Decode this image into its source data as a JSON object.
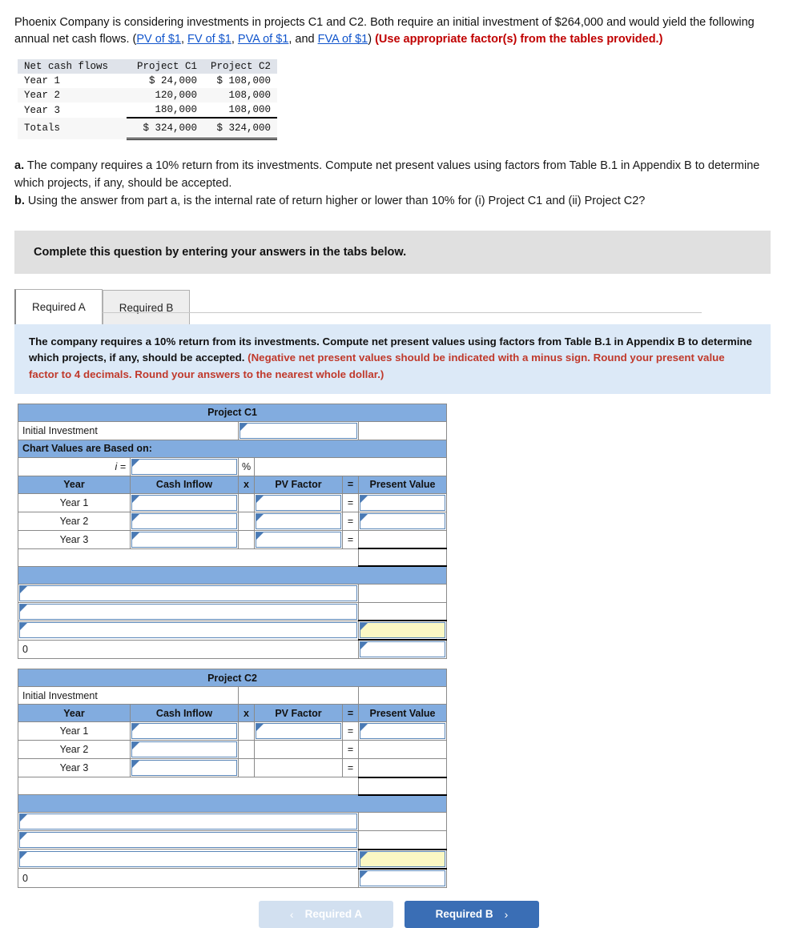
{
  "intro": {
    "text_part1": "Phoenix Company is considering investments in projects C1 and C2. Both require an initial investment of $264,000 and would yield the following annual net cash flows. (",
    "link_pv": "PV of $1",
    "sep1": ", ",
    "link_fv": "FV of $1",
    "sep2": ", ",
    "link_pva": "PVA of $1",
    "sep3": ", and ",
    "link_fva": "FVA of $1",
    "sep4": ") ",
    "bold_red": "(Use appropriate factor(s) from the tables provided.)"
  },
  "cash_table": {
    "headers": [
      "Net cash flows",
      "Project C1",
      "Project C2"
    ],
    "rows": [
      {
        "label": "Year 1",
        "c1": "$ 24,000",
        "c2": "$ 108,000"
      },
      {
        "label": "Year 2",
        "c1": "120,000",
        "c2": "108,000"
      },
      {
        "label": "Year 3",
        "c1": "180,000",
        "c2": "108,000"
      }
    ],
    "totals": {
      "label": "Totals",
      "c1": "$ 324,000",
      "c2": "$ 324,000"
    }
  },
  "questions": {
    "a_marker": "a.",
    "a_text": " The company requires a 10% return from its investments. Compute net present values using factors from Table B.1 in Appendix B to determine which projects, if any, should be accepted.",
    "b_marker": "b.",
    "b_text": " Using the answer from part a, is the internal rate of return higher or lower than 10% for (i) Project C1 and (ii) Project C2?"
  },
  "banner": {
    "text": "Complete this question by entering your answers in the tabs below."
  },
  "tabs": [
    {
      "label": "Required A",
      "active": true
    },
    {
      "label": "Required B",
      "active": false
    }
  ],
  "instruction_panel": {
    "black_text": "The company requires a 10% return from its investments. Compute net present values using factors from Table B.1 in Appendix B to determine which projects, if any, should be accepted. ",
    "red_text": "(Negative net present values should be indicated with a minus sign. Round your present value factor to 4 decimals. Round your answers to the nearest whole dollar.)"
  },
  "grid_c1": {
    "title": "Project C1",
    "initial_investment_label": "Initial Investment",
    "initial_investment_value": "",
    "chart_values_label": "Chart Values are Based on:",
    "i_label": "i =",
    "i_value": "",
    "percent_symbol": "%",
    "columns": [
      "Year",
      "Cash Inflow",
      "x",
      "PV Factor",
      "=",
      "Present Value"
    ],
    "rows": [
      {
        "year": "Year 1",
        "cash_inflow": "",
        "pv_factor": "",
        "equals": "=",
        "present_value": ""
      },
      {
        "year": "Year 2",
        "cash_inflow": "",
        "pv_factor": "",
        "equals": "=",
        "present_value": ""
      },
      {
        "year": "Year 3",
        "cash_inflow": "",
        "pv_factor": "",
        "equals": "=",
        "present_value": ""
      }
    ],
    "subtotal_value": "",
    "summary_rows": [
      {
        "label": "",
        "value": ""
      },
      {
        "label": "",
        "value": ""
      },
      {
        "label": "",
        "value": "",
        "highlight": true
      },
      {
        "label": "0",
        "value": ""
      }
    ]
  },
  "grid_c2": {
    "title": "Project C2",
    "initial_investment_label": "Initial Investment",
    "initial_investment_value": "",
    "columns": [
      "Year",
      "Cash Inflow",
      "x",
      "PV Factor",
      "=",
      "Present Value"
    ],
    "rows": [
      {
        "year": "Year 1",
        "cash_inflow": "",
        "pv_factor": "",
        "equals": "=",
        "present_value": ""
      },
      {
        "year": "Year 2",
        "cash_inflow": "",
        "pv_factor": "",
        "equals": "=",
        "present_value": ""
      },
      {
        "year": "Year 3",
        "cash_inflow": "",
        "pv_factor": "",
        "equals": "=",
        "present_value": ""
      }
    ],
    "subtotal_value": "",
    "summary_rows": [
      {
        "label": "",
        "value": ""
      },
      {
        "label": "",
        "value": ""
      },
      {
        "label": "",
        "value": "",
        "highlight": true
      },
      {
        "label": "0",
        "value": ""
      }
    ]
  },
  "footer": {
    "prev_label": "Required A",
    "prev_chevron": "‹",
    "next_label": "Required B",
    "next_chevron": "›"
  },
  "colors": {
    "header_blue": "#82acdf",
    "panel_blue": "#dce9f7",
    "highlight_yellow": "#fbf8c4",
    "accent_red": "#c00000",
    "link_blue": "#1155cc",
    "button_blue": "#3a6eb5"
  }
}
